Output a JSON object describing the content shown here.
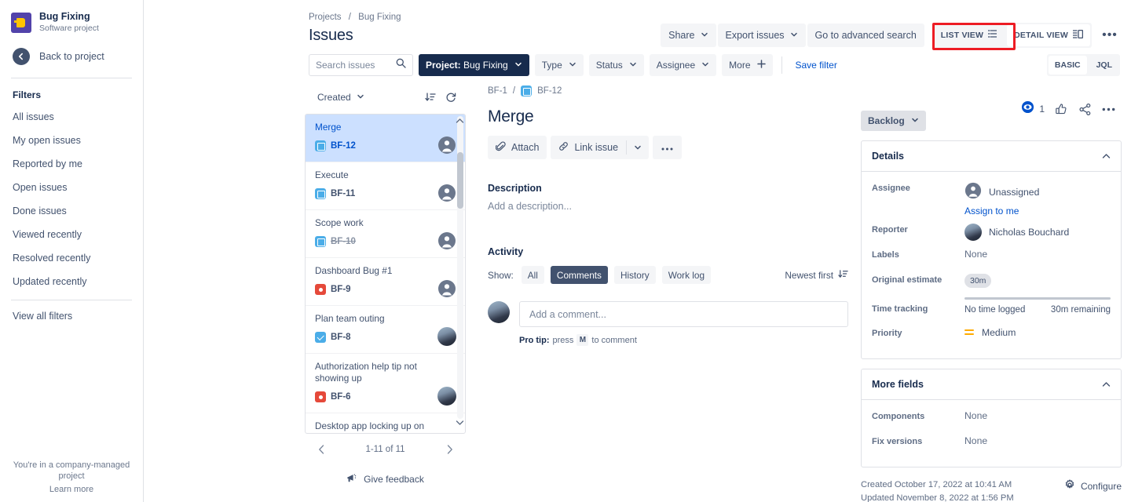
{
  "sidebar": {
    "project": {
      "name": "Bug Fixing",
      "type": "Software project"
    },
    "back": "Back to project",
    "filters_title": "Filters",
    "items": [
      {
        "label": "All issues"
      },
      {
        "label": "My open issues"
      },
      {
        "label": "Reported by me"
      },
      {
        "label": "Open issues"
      },
      {
        "label": "Done issues"
      },
      {
        "label": "Viewed recently"
      },
      {
        "label": "Resolved recently"
      },
      {
        "label": "Updated recently"
      }
    ],
    "view_all": "View all filters",
    "company_managed": "You're in a company-managed project",
    "learn_more": "Learn more"
  },
  "header": {
    "breadcrumb_projects": "Projects",
    "breadcrumb_sep": "/",
    "breadcrumb_project": "Bug Fixing",
    "title": "Issues",
    "share": "Share",
    "export": "Export issues",
    "advanced_search": "Go to advanced search",
    "list_view": "LIST VIEW",
    "detail_view": "DETAIL VIEW",
    "more_dots": "•••"
  },
  "filterbar": {
    "search_placeholder": "Search issues",
    "search_value": "",
    "project_label": "Project:",
    "project_value": "Bug Fixing",
    "type": "Type",
    "status": "Status",
    "assignee": "Assignee",
    "more": "More",
    "save_filter": "Save filter",
    "basic": "BASIC",
    "jql": "JQL"
  },
  "issue_list": {
    "sort_label": "Created",
    "pagination": "1-11 of 11",
    "feedback": "Give feedback",
    "items": [
      {
        "title": "Merge",
        "key": "BF-12",
        "type": "story",
        "avatar": "anon",
        "selected": true,
        "done": false
      },
      {
        "title": "Execute",
        "key": "BF-11",
        "type": "story",
        "avatar": "anon",
        "selected": false,
        "done": false
      },
      {
        "title": "Scope work",
        "key": "BF-10",
        "type": "story",
        "avatar": "anon",
        "selected": false,
        "done": true
      },
      {
        "title": "Dashboard Bug #1",
        "key": "BF-9",
        "type": "bug",
        "avatar": "anon",
        "selected": false,
        "done": false
      },
      {
        "title": "Plan team outing",
        "key": "BF-8",
        "type": "task",
        "avatar": "photo",
        "selected": false,
        "done": false
      },
      {
        "title": "Authorization help tip not showing up",
        "key": "BF-6",
        "type": "bug",
        "avatar": "photo",
        "selected": false,
        "done": false
      },
      {
        "title": "Desktop app locking up on Mac",
        "key": "",
        "type": "bug",
        "avatar": "photo",
        "selected": false,
        "done": false
      }
    ]
  },
  "detail": {
    "parent_key": "BF-1",
    "crumb_sep": "/",
    "issue_key": "BF-12",
    "title": "Merge",
    "watch_count": "1",
    "attach": "Attach",
    "link_issue": "Link issue",
    "description_label": "Description",
    "description_placeholder": "Add a description...",
    "activity_label": "Activity",
    "show_label": "Show:",
    "tabs": [
      {
        "label": "All",
        "active": false
      },
      {
        "label": "Comments",
        "active": true
      },
      {
        "label": "History",
        "active": false
      },
      {
        "label": "Work log",
        "active": false
      }
    ],
    "sort_order": "Newest first",
    "comment_placeholder": "Add a comment...",
    "protip_prefix": "Pro tip:",
    "protip_mid": "press",
    "protip_key": "M",
    "protip_suffix": "to comment"
  },
  "details_panel": {
    "status": "Backlog",
    "title": "Details",
    "fields": [
      {
        "key": "Assignee",
        "value": "Unassigned",
        "kind": "assignee",
        "link": "Assign to me"
      },
      {
        "key": "Reporter",
        "value": "Nicholas Bouchard",
        "kind": "reporter"
      },
      {
        "key": "Labels",
        "value": "None",
        "kind": "text"
      },
      {
        "key": "Original estimate",
        "value": "30m",
        "kind": "pill"
      },
      {
        "key": "Time tracking",
        "value": "No time logged",
        "value2": "30m remaining",
        "kind": "time"
      },
      {
        "key": "Priority",
        "value": "Medium",
        "kind": "priority"
      }
    ]
  },
  "more_fields_panel": {
    "title": "More fields",
    "fields": [
      {
        "key": "Components",
        "value": "None"
      },
      {
        "key": "Fix versions",
        "value": "None"
      }
    ]
  },
  "footer_meta": {
    "created": "Created October 17, 2022 at 10:41 AM",
    "updated": "Updated November 8, 2022 at 1:56 PM",
    "configure": "Configure"
  },
  "colors": {
    "accent_blue": "#0052cc",
    "highlight_red": "#ed1c24",
    "dark_navy": "#172b4d",
    "selected_row": "#cce0ff",
    "priority_orange": "#ffab00"
  }
}
